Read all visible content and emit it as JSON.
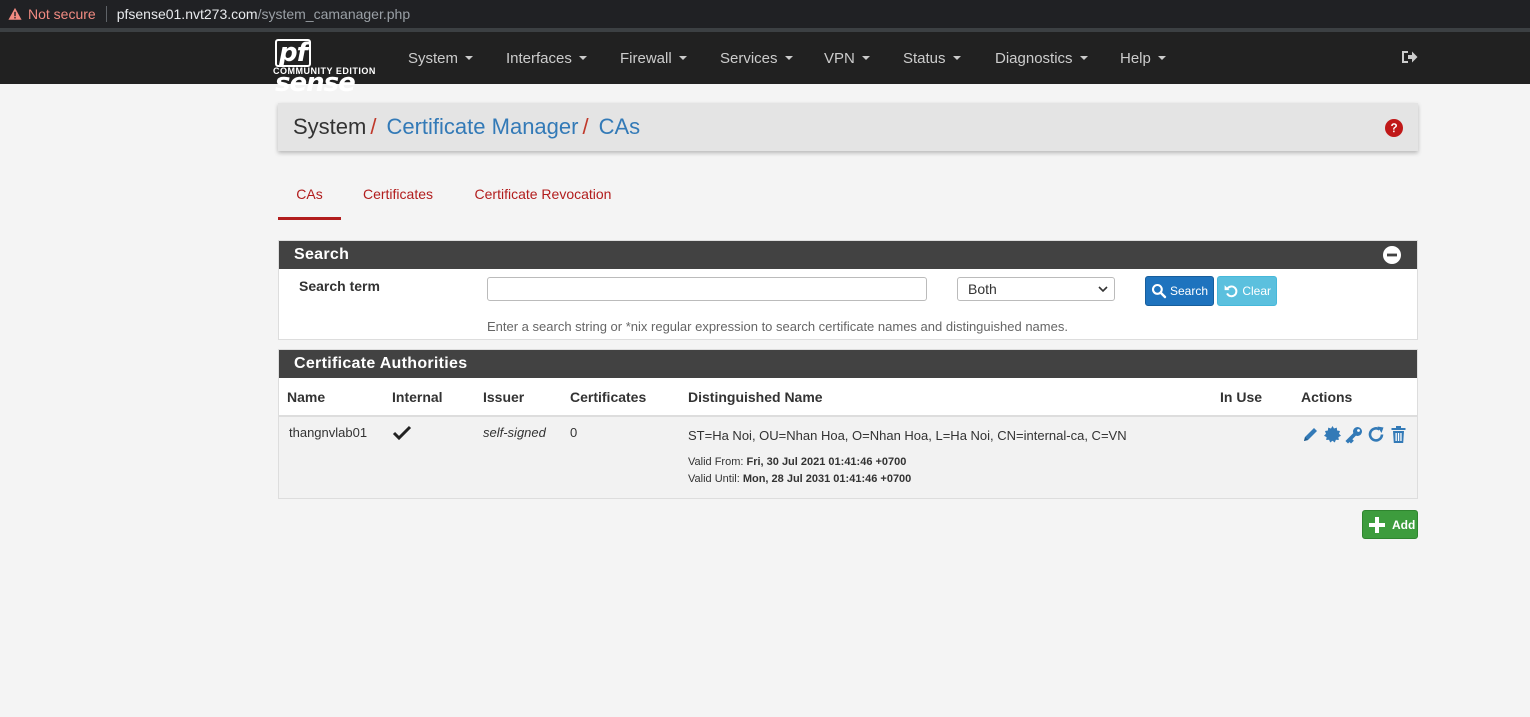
{
  "browser": {
    "security": "Not secure",
    "host": "pfsense01.nvt273.com",
    "path": "/system_camanager.php"
  },
  "brand": {
    "logo_text": "pfsense",
    "edition": "COMMUNITY EDITION"
  },
  "nav": {
    "items": [
      {
        "label": "System"
      },
      {
        "label": "Interfaces"
      },
      {
        "label": "Firewall"
      },
      {
        "label": "Services"
      },
      {
        "label": "VPN"
      },
      {
        "label": "Status"
      },
      {
        "label": "Diagnostics"
      },
      {
        "label": "Help"
      }
    ],
    "logout_icon": "sign-out-icon"
  },
  "breadcrumb": {
    "root": "System",
    "section": "Certificate Manager",
    "page": "CAs",
    "help_icon": "question-circle-icon"
  },
  "tabs": [
    {
      "label": "CAs",
      "active": true
    },
    {
      "label": "Certificates",
      "active": false
    },
    {
      "label": "Certificate Revocation",
      "active": false
    }
  ],
  "search_panel": {
    "title": "Search",
    "term_label": "Search term",
    "term_value": "",
    "scope_selected": "Both",
    "search_button": "Search",
    "clear_button": "Clear",
    "hint": "Enter a search string or *nix regular expression to search certificate names and distinguished names."
  },
  "ca_panel": {
    "title": "Certificate Authorities",
    "columns": [
      "Name",
      "Internal",
      "Issuer",
      "Certificates",
      "Distinguished Name",
      "In Use",
      "Actions"
    ],
    "rows": [
      {
        "name": "thangnvlab01",
        "internal": true,
        "issuer": "self-signed",
        "certificates": "0",
        "dn": "ST=Ha Noi, OU=Nhan Hoa, O=Nhan Hoa, L=Ha Noi, CN=internal-ca, C=VN",
        "valid_from_label": "Valid From:",
        "valid_from": "Fri, 30 Jul 2021 01:41:46 +0700",
        "valid_until_label": "Valid Until:",
        "valid_until": "Mon, 28 Jul 2031 01:41:46 +0700",
        "in_use": "",
        "actions": [
          "pencil-icon",
          "certificate-icon",
          "key-icon",
          "refresh-icon",
          "trash-icon"
        ]
      }
    ]
  },
  "add_button": "Add",
  "colors": {
    "navbar": "#212121",
    "accent_red": "#b21d1d",
    "link_blue": "#337ab7",
    "panel_head": "#424242",
    "add_green": "#3d9c3d"
  }
}
